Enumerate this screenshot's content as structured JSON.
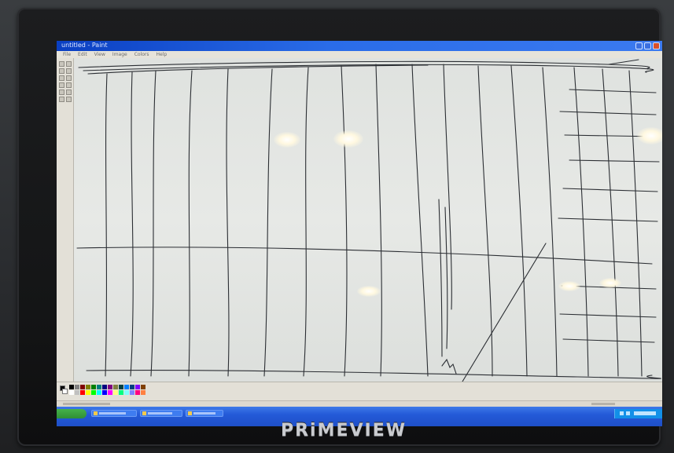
{
  "monitor": {
    "brand": "PRiMEVIEW",
    "bezel_color": "#161718"
  },
  "paint_window": {
    "title": "untitled - Paint",
    "menus": [
      "File",
      "Edit",
      "View",
      "Image",
      "Colors",
      "Help"
    ],
    "canvas_color": "#e3e6e3",
    "stroke_color": "#2b2e33",
    "tools": [
      "free-select-icon",
      "select-icon",
      "eraser-icon",
      "fill-icon",
      "color-picker-icon",
      "magnifier-icon",
      "pencil-icon",
      "brush-icon",
      "airbrush-icon",
      "text-icon",
      "line-icon",
      "curve-icon"
    ]
  },
  "palette": {
    "foreground": "#000000",
    "background": "#ffffff",
    "colors": [
      "#000000",
      "#808080",
      "#800000",
      "#808000",
      "#008000",
      "#008080",
      "#000080",
      "#800080",
      "#808040",
      "#004040",
      "#0080ff",
      "#004080",
      "#8000ff",
      "#804000",
      "#ffffff",
      "#c0c0c0",
      "#ff0000",
      "#ffff00",
      "#00ff00",
      "#00ffff",
      "#0000ff",
      "#ff00ff",
      "#ffff80",
      "#00ff80",
      "#80ffff",
      "#8080ff",
      "#ff0080",
      "#ff8040"
    ]
  },
  "taskbar": {
    "color": "#245ad8",
    "start_color": "#3a9c3f",
    "items": 4
  }
}
